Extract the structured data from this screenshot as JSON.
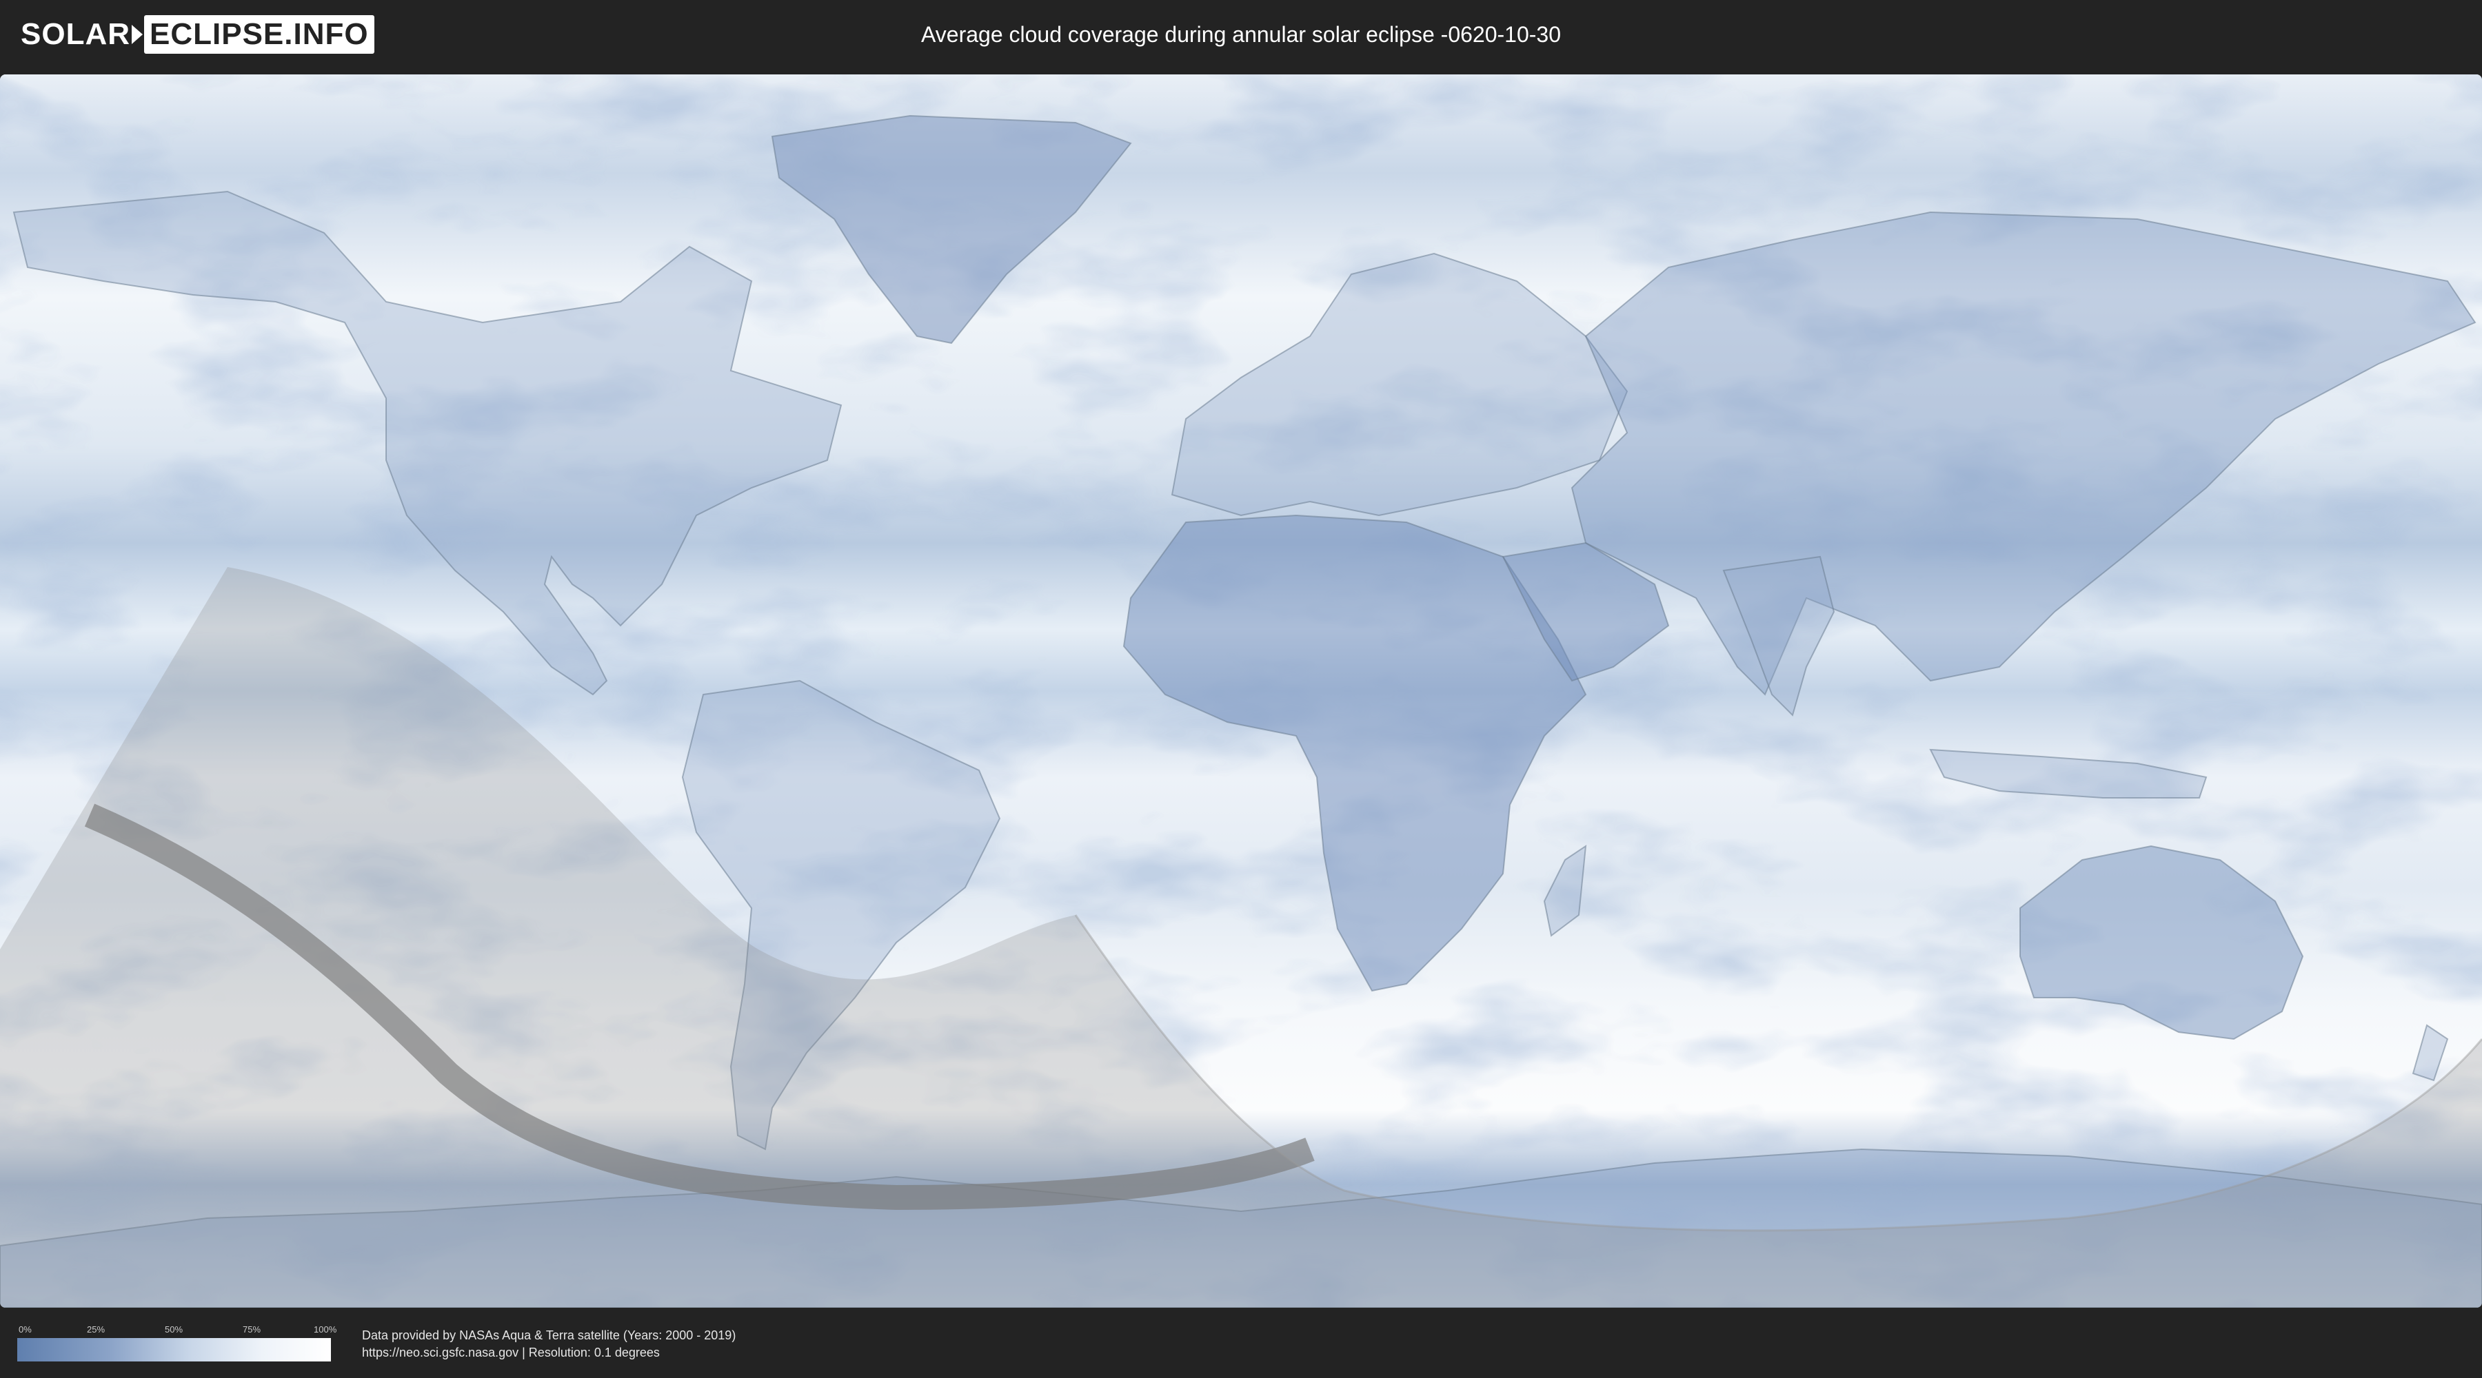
{
  "header": {
    "logo_left": "SOLAR",
    "logo_right": "ECLIPSE.INFO",
    "title": "Average cloud coverage during annular solar eclipse -0620-10-30"
  },
  "legend": {
    "ticks": [
      "0%",
      "25%",
      "50%",
      "75%",
      "100%"
    ],
    "scale_colors": [
      "#5f7fae",
      "#ffffff"
    ]
  },
  "footer": {
    "source_line": "Data provided by NASAs Aqua & Terra satellite (Years: 2000 - 2019)",
    "url_line": "https://neo.sci.gsfc.nasa.gov | Resolution: 0.1 degrees"
  },
  "map": {
    "type": "equirectangular world map",
    "features": [
      "cloud coverage heatmap",
      "penumbral visibility zone",
      "annularity path"
    ],
    "colors": {
      "clear_sky": "#5f7fae",
      "overcast": "#ffffff",
      "eclipse_overlay": "#8c8c8c",
      "background": "#232323"
    }
  }
}
